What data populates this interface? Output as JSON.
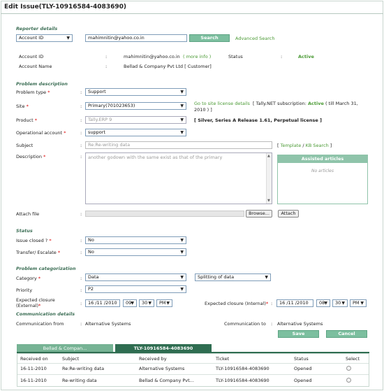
{
  "title": "Edit Issue(TLY-10916584-4083690)",
  "reporter": {
    "section": "Reporter details",
    "search_by": "Account ID",
    "search_value": "mahimnitin@yahoo.co.in",
    "search_button": "Search",
    "advanced_search": "Advanced Search",
    "account_id_label": "Account ID",
    "account_id_value": "mahimnitin@yahoo.co.in",
    "more_info": "( more info )",
    "status_label": "Status",
    "status_value": "Active",
    "account_name_label": "Account Name",
    "account_name_value": "Bellad & Company Pvt Ltd [ Customer]"
  },
  "problem": {
    "section": "Problem description",
    "problem_type_label": "Problem type",
    "problem_type_value": "Support",
    "site_label": "Site",
    "site_value": "Primary(701023653)",
    "site_link": "Go to site license details",
    "site_info_prefix": "[ Tally.NET subscription:",
    "site_info_status": "Active",
    "site_info_suffix": "( till March 31,",
    "site_info_line2": "2010 ) ]",
    "product_label": "Product",
    "product_value": "Tally.ERP 9",
    "product_info": "[ Silver, Series A Release 1.61, Perpetual license ]",
    "operational_label": "Operational account",
    "operational_value": "support",
    "subject_label": "Subject",
    "subject_value": "Re:Re-writing data",
    "template_link": "Template",
    "kb_link": "KB Search",
    "description_label": "Description",
    "description_value": "another godown with the same exist as that of the primary",
    "assisted_title": "Assisted articles",
    "assisted_empty": "No articles",
    "attach_label": "Attach file",
    "browse_button": "Browse...",
    "attach_button": "Attach"
  },
  "status": {
    "section": "Status",
    "closed_label": "Issue closed ?",
    "closed_value": "No",
    "transfer_label": "Transfer/ Escalate",
    "transfer_value": "No"
  },
  "categorization": {
    "section": "Problem categorization",
    "category_label": "Category",
    "category_value": "Data",
    "subcategory_value": "Splitting of data",
    "priority_label": "Priority",
    "priority_value": "P2",
    "external_label_1": "Expected closure",
    "external_label_2": "(External)",
    "external_date": "16 /11 /2010",
    "external_hour": "09",
    "external_min": "30",
    "external_ampm": "PM",
    "internal_label": "Expected closure (Internal)",
    "internal_date": "16 /11 /2010",
    "internal_hour": "08",
    "internal_min": "30",
    "internal_ampm": "PM"
  },
  "communication": {
    "section": "Communication details",
    "from_label": "Communication from",
    "from_value": "Alternative Systems",
    "to_label": "Communication to",
    "to_value": "Alternative Systems"
  },
  "actions": {
    "save": "Save",
    "cancel": "Cancel"
  },
  "tabs": [
    {
      "label": "Bellad & Compan..."
    },
    {
      "label": "TLY-10916584-4083690"
    }
  ],
  "grid": {
    "headers": [
      "Received on",
      "Subject",
      "Received by",
      "Ticket",
      "Status",
      "Select"
    ],
    "rows": [
      {
        "received_on": "16-11-2010",
        "subject": "Re:Re-writing data",
        "received_by": "Alternative Systems",
        "ticket": "TLY-10916584-4083690",
        "status": "Opened"
      },
      {
        "received_on": "16-11-2010",
        "subject": "Re-writing data",
        "received_by": "Bellad & Company Pvt...",
        "ticket": "TLY-10916584-4083690",
        "status": "Opened"
      }
    ]
  },
  "colors": {
    "accent": "#7cbf9f",
    "section": "#3d6f56",
    "link": "#4a9a34",
    "tab_active": "#2f6d51"
  }
}
